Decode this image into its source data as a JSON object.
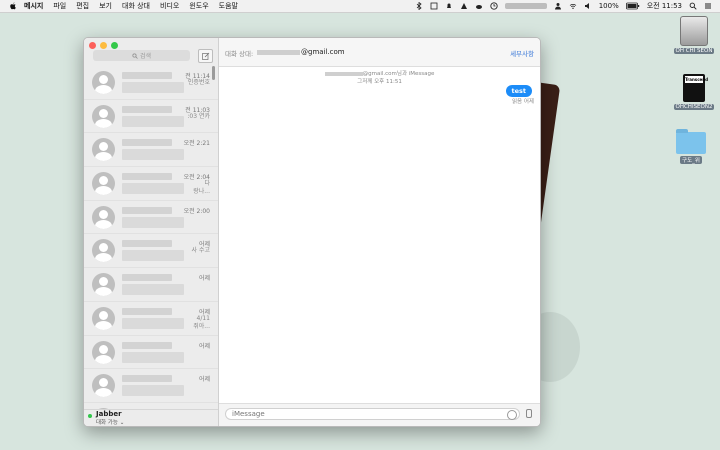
{
  "menubar": {
    "app_name": "메시지",
    "menus": [
      "파일",
      "편집",
      "보기",
      "대화 상대",
      "비디오",
      "윈도우",
      "도움말"
    ],
    "battery": "100%",
    "clock": "오전 11:53"
  },
  "desktop": {
    "icons": [
      {
        "label": "OH CHI SEON",
        "icon": "hard-drive-icon"
      },
      {
        "label": "OHCHISEON2",
        "icon": "sd-card-icon",
        "card_text": "Transcend"
      },
      {
        "label": "구도_위",
        "icon": "folder-icon"
      }
    ]
  },
  "sidebar": {
    "search_placeholder": "검색",
    "conversations": [
      {
        "time": "전 11:14",
        "preview": "인증번호"
      },
      {
        "time": "전 11:03",
        "preview": ":03 연카"
      },
      {
        "time": "오전 2:21",
        "preview": ""
      },
      {
        "time": "오전 2:04",
        "preview": "다\n랑나..."
      },
      {
        "time": "오전 2:00",
        "preview": ""
      },
      {
        "time": "어제",
        "preview": "사 수고"
      },
      {
        "time": "어제",
        "preview": ""
      },
      {
        "time": "어제",
        "preview": "4/11\n쥐아..."
      },
      {
        "time": "어제",
        "preview": ""
      },
      {
        "time": "어제",
        "preview": ""
      },
      {
        "time": "어제",
        "preview": ""
      }
    ],
    "status": {
      "name": "Jabber",
      "availability": "대화 가능"
    }
  },
  "chat": {
    "to_label": "대화 상대:",
    "to_value": "@gmail.com",
    "details_label": "세부사항",
    "meta_line1": "@gmail.com님과 iMessage",
    "meta_line2": "그저께 오후 11:51",
    "message": "test",
    "read_receipt": "읽음 어제",
    "input_placeholder": "iMessage"
  }
}
